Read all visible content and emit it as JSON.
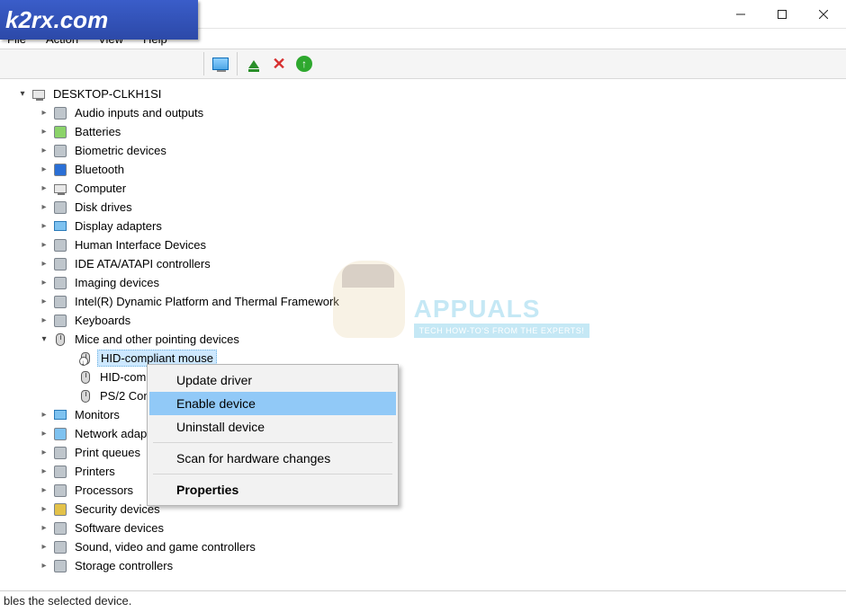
{
  "watermark": "k2rx.com",
  "menus": {
    "file": "File",
    "action": "Action",
    "view": "View",
    "help": "Help"
  },
  "tree": {
    "root": "DESKTOP-CLKH1SI",
    "nodes": [
      {
        "label": "Audio inputs and outputs"
      },
      {
        "label": "Batteries"
      },
      {
        "label": "Biometric devices"
      },
      {
        "label": "Bluetooth"
      },
      {
        "label": "Computer"
      },
      {
        "label": "Disk drives"
      },
      {
        "label": "Display adapters"
      },
      {
        "label": "Human Interface Devices"
      },
      {
        "label": "IDE ATA/ATAPI controllers"
      },
      {
        "label": "Imaging devices"
      },
      {
        "label": "Intel(R) Dynamic Platform and Thermal Framework"
      },
      {
        "label": "Keyboards"
      },
      {
        "label": "Mice and other pointing devices",
        "expanded": true,
        "children": [
          {
            "label": "HID-compliant mouse",
            "selected": true,
            "disabled": true
          },
          {
            "label": "HID-compl"
          },
          {
            "label": "PS/2 Comp"
          }
        ]
      },
      {
        "label": "Monitors"
      },
      {
        "label": "Network adapt"
      },
      {
        "label": "Print queues"
      },
      {
        "label": "Printers"
      },
      {
        "label": "Processors"
      },
      {
        "label": "Security devices"
      },
      {
        "label": "Software devices"
      },
      {
        "label": "Sound, video and game controllers"
      },
      {
        "label": "Storage controllers"
      }
    ]
  },
  "context_menu": {
    "update": "Update driver",
    "enable": "Enable device",
    "uninstall": "Uninstall device",
    "scan": "Scan for hardware changes",
    "properties": "Properties"
  },
  "appuals": {
    "title": "APPUALS",
    "tag": "TECH HOW-TO'S FROM THE EXPERTS!"
  },
  "status": "bles the selected device."
}
